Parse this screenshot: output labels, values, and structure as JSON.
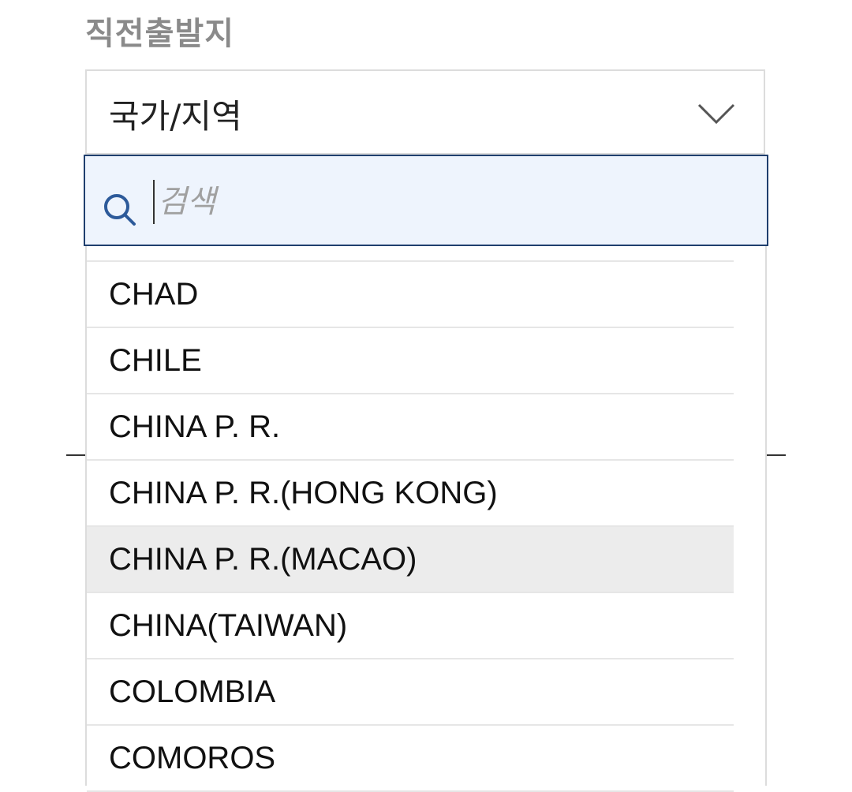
{
  "field": {
    "label": "직전출발지"
  },
  "select": {
    "value": "국가/지역",
    "icon": "chevron-down-icon"
  },
  "search": {
    "placeholder": "검색",
    "value": "",
    "icon": "search-icon"
  },
  "colors": {
    "search_bg": "#eef4fd",
    "search_border": "#1f3f6e",
    "highlight": "#ececec",
    "label": "#8a8a8a"
  },
  "options": [
    {
      "label": "CHAD",
      "highlighted": false
    },
    {
      "label": "CHILE",
      "highlighted": false
    },
    {
      "label": "CHINA P. R.",
      "highlighted": false
    },
    {
      "label": "CHINA P. R.(HONG KONG)",
      "highlighted": false
    },
    {
      "label": "CHINA P. R.(MACAO)",
      "highlighted": true
    },
    {
      "label": "CHINA(TAIWAN)",
      "highlighted": false
    },
    {
      "label": "COLOMBIA",
      "highlighted": false
    },
    {
      "label": "COMOROS",
      "highlighted": false
    }
  ]
}
